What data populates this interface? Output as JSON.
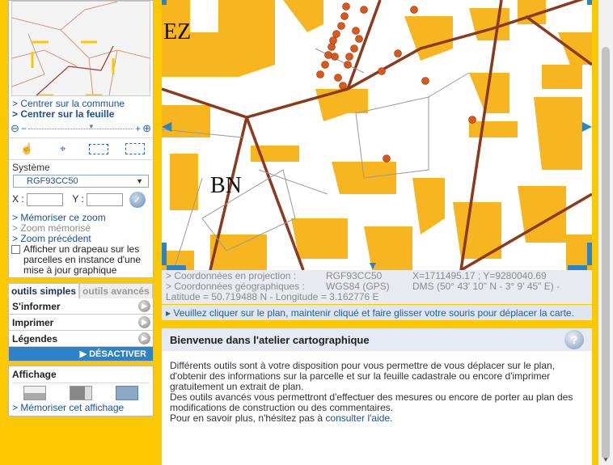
{
  "sidebar": {
    "center_commune": "> Centrer sur la commune",
    "center_feuille": "> Centrer sur la feuille",
    "systeme_label": "Système",
    "systeme_value": "RGF93CC50",
    "x_label": "X :",
    "y_label": "Y :",
    "memoriser_zoom": "> Mémoriser ce zoom",
    "zoom_memorise": "> Zoom mémorisé",
    "zoom_precedent": "> Zoom précédent",
    "drapeau_label": "Afficher un drapeau sur les parcelles en instance d'une mise à jour graphique",
    "tab_simple": "outils simples",
    "tab_avances": "outils avancés",
    "menu": [
      "S'informer",
      "Imprimer",
      "Légendes"
    ],
    "desactiver": "DÉSACTIVER",
    "affichage_title": "Affichage",
    "memoriser_affichage": "> Mémoriser cet affichage"
  },
  "map": {
    "label_ez": "EZ",
    "label_bn": "BN"
  },
  "coords": {
    "proj_label": "> Coordonnées en projection :",
    "proj_system": "RGF93CC50",
    "proj_value": "X=1711495.17 ; Y=9280040.69",
    "geo_label": "> Coordonnées géographiques :",
    "geo_system": "WGS84 (GPS)",
    "geo_dms": "DMS (50° 43' 10\" N - 3° 9' 45\" E) -",
    "geo_decimal": "Latitude = 50.719488 N - Longitude = 3.162776 E"
  },
  "hint": "▸ Veuillez cliquer sur le plan, maintenir cliqué et faire glisser votre souris pour déplacer la carte.",
  "welcome": {
    "title": "Bienvenue dans l'atelier cartographique",
    "p1": "Différents outils sont à votre disposition pour vous permettre de vous déplacer sur le plan, d'obtenir des informations sur la parcelle et sur la feuille cadastrale ou encore d'imprimer gratuitement un extrait de plan.",
    "p2": "Des outils avancés vous permettront d'effectuer des mesures ou encore de porter au plan des modifications de construction ou des commentaires.",
    "p3_prefix": "Pour en savoir plus, n'hésitez pas à",
    "p3_link": "consulter l'aide",
    "p3_suffix": "."
  },
  "colors": {
    "background": "#fcc800",
    "building": "#f7b520",
    "road": "#8b3a1e",
    "accent": "#2b84c6"
  }
}
